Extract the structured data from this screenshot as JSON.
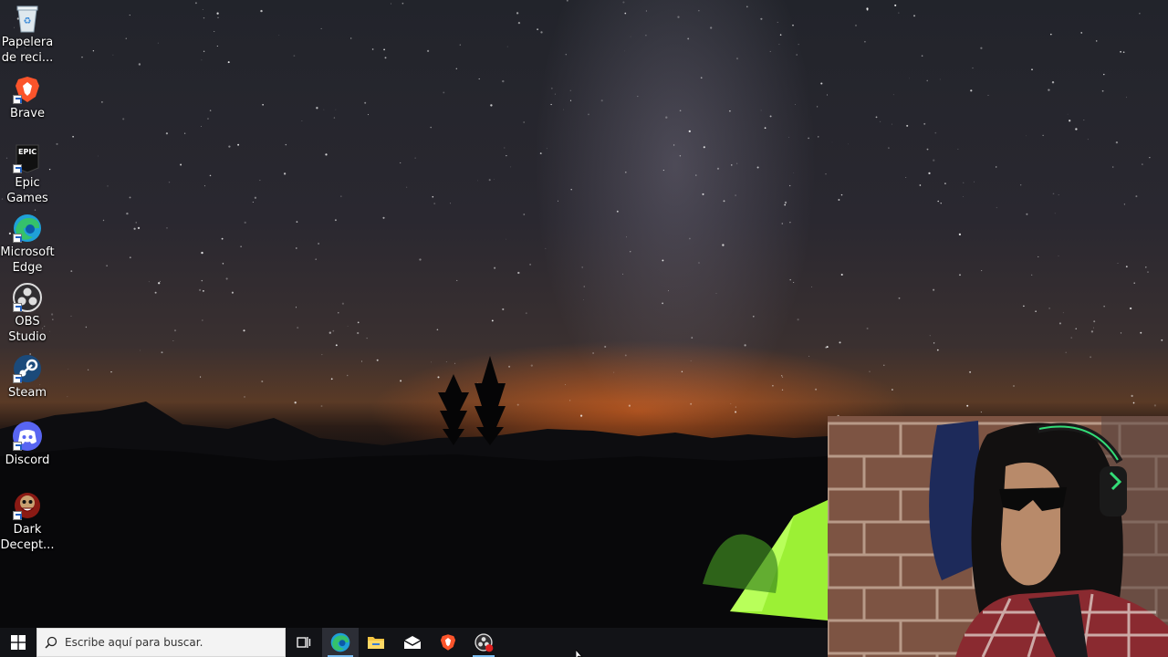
{
  "desktop": {
    "icons": [
      {
        "label_line1": "Papelera",
        "label_line2": "de reci...",
        "icon": "recycle-bin-icon"
      },
      {
        "label_line1": "Brave",
        "label_line2": "",
        "icon": "brave-icon"
      },
      {
        "label_line1": "Epic",
        "label_line2": "Games ...",
        "icon": "epic-games-icon",
        "badge": "EPIC"
      },
      {
        "label_line1": "Microsoft",
        "label_line2": "Edge",
        "icon": "edge-icon"
      },
      {
        "label_line1": "OBS",
        "label_line2": "Studio",
        "icon": "obs-icon"
      },
      {
        "label_line1": "Steam",
        "label_line2": "",
        "icon": "steam-icon"
      },
      {
        "label_line1": "Discord",
        "label_line2": "",
        "icon": "discord-icon"
      },
      {
        "label_line1": "Dark",
        "label_line2": "Decept...",
        "icon": "dark-deception-icon"
      }
    ]
  },
  "taskbar": {
    "search_placeholder": "Escribe aquí para buscar.",
    "apps": [
      "start-icon",
      "task-view-icon",
      "edge-icon",
      "file-explorer-icon",
      "mail-icon",
      "brave-icon",
      "obs-recording-icon"
    ]
  },
  "colors": {
    "taskbar_bg": "#121317",
    "accent": "#76b9ed",
    "brave": "#fb542b",
    "discord": "#5865f2",
    "steam": "#1b2838",
    "edge": "#1fa0d8"
  }
}
